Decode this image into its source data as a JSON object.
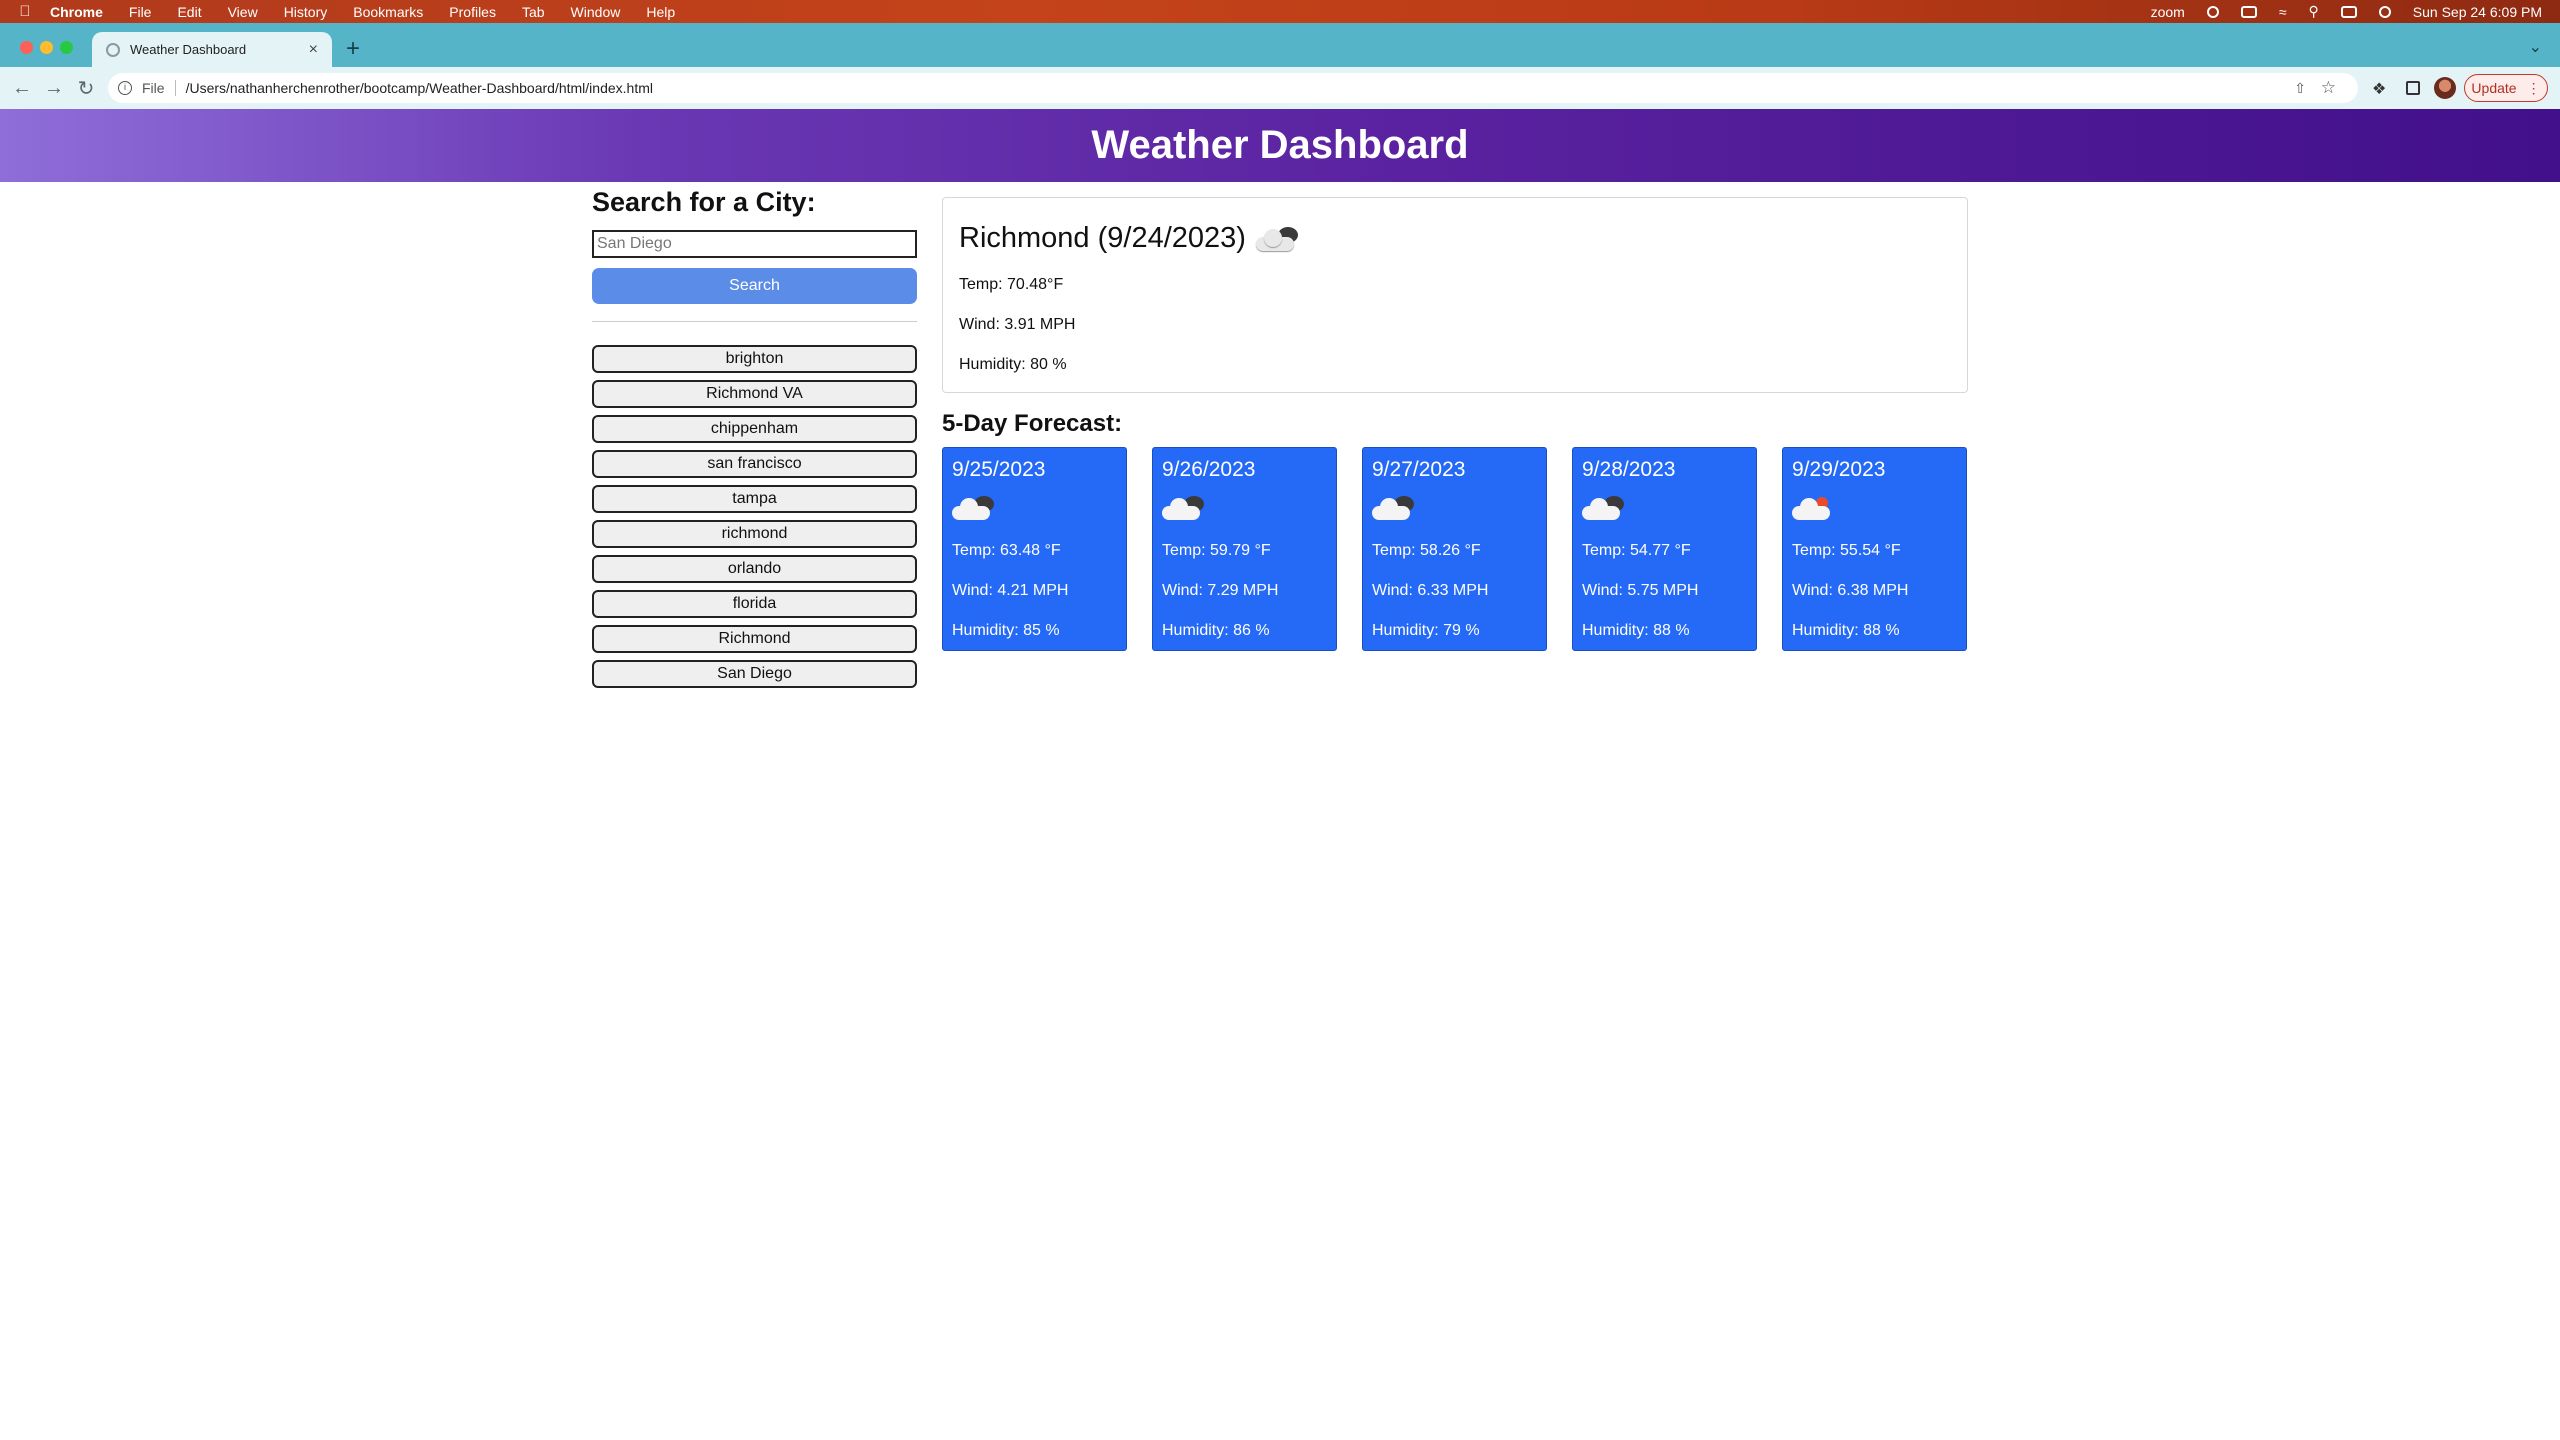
{
  "os": {
    "menubar": {
      "app": "Chrome",
      "items": [
        "File",
        "Edit",
        "View",
        "History",
        "Bookmarks",
        "Profiles",
        "Tab",
        "Window",
        "Help"
      ],
      "zoom": "zoom",
      "datetime": "Sun Sep 24  6:09 PM"
    }
  },
  "browser": {
    "tab_title": "Weather Dashboard",
    "address_scheme": "File",
    "address_url": "/Users/nathanherchenrother/bootcamp/Weather-Dashboard/html/index.html",
    "update_label": "Update"
  },
  "app": {
    "title": "Weather Dashboard"
  },
  "search": {
    "heading": "Search for a City:",
    "placeholder": "San Diego",
    "button_label": "Search"
  },
  "history": [
    "brighton",
    "Richmond VA",
    "chippenham",
    "san francisco",
    "tampa",
    "richmond",
    "orlando",
    "florida",
    "Richmond",
    "San Diego"
  ],
  "current": {
    "title": "Richmond (9/24/2023)",
    "icon": "cloudy-night-icon",
    "temp": "Temp: 70.48°F",
    "wind": "Wind: 3.91 MPH",
    "humidity": "Humidity: 80 %"
  },
  "forecast": {
    "heading": "5-Day Forecast:",
    "days": [
      {
        "date": "9/25/2023",
        "icon": "cloudy-icon",
        "temp": "Temp: 63.48 °F",
        "wind": "Wind: 4.21 MPH",
        "humidity": "Humidity: 85 %"
      },
      {
        "date": "9/26/2023",
        "icon": "cloudy-icon",
        "temp": "Temp: 59.79 °F",
        "wind": "Wind: 7.29 MPH",
        "humidity": "Humidity: 86 %"
      },
      {
        "date": "9/27/2023",
        "icon": "cloudy-icon",
        "temp": "Temp: 58.26 °F",
        "wind": "Wind: 6.33 MPH",
        "humidity": "Humidity: 79 %"
      },
      {
        "date": "9/28/2023",
        "icon": "cloudy-icon",
        "temp": "Temp: 54.77 °F",
        "wind": "Wind: 5.75 MPH",
        "humidity": "Humidity: 88 %"
      },
      {
        "date": "9/29/2023",
        "icon": "partly-sunny-icon",
        "temp": "Temp: 55.54 °F",
        "wind": "Wind: 6.38 MPH",
        "humidity": "Humidity: 88 %"
      }
    ]
  },
  "colors": {
    "header_start": "#8f6ed9",
    "header_end": "#42108a",
    "search_button": "#5b8de8",
    "forecast_card": "#256af6"
  }
}
